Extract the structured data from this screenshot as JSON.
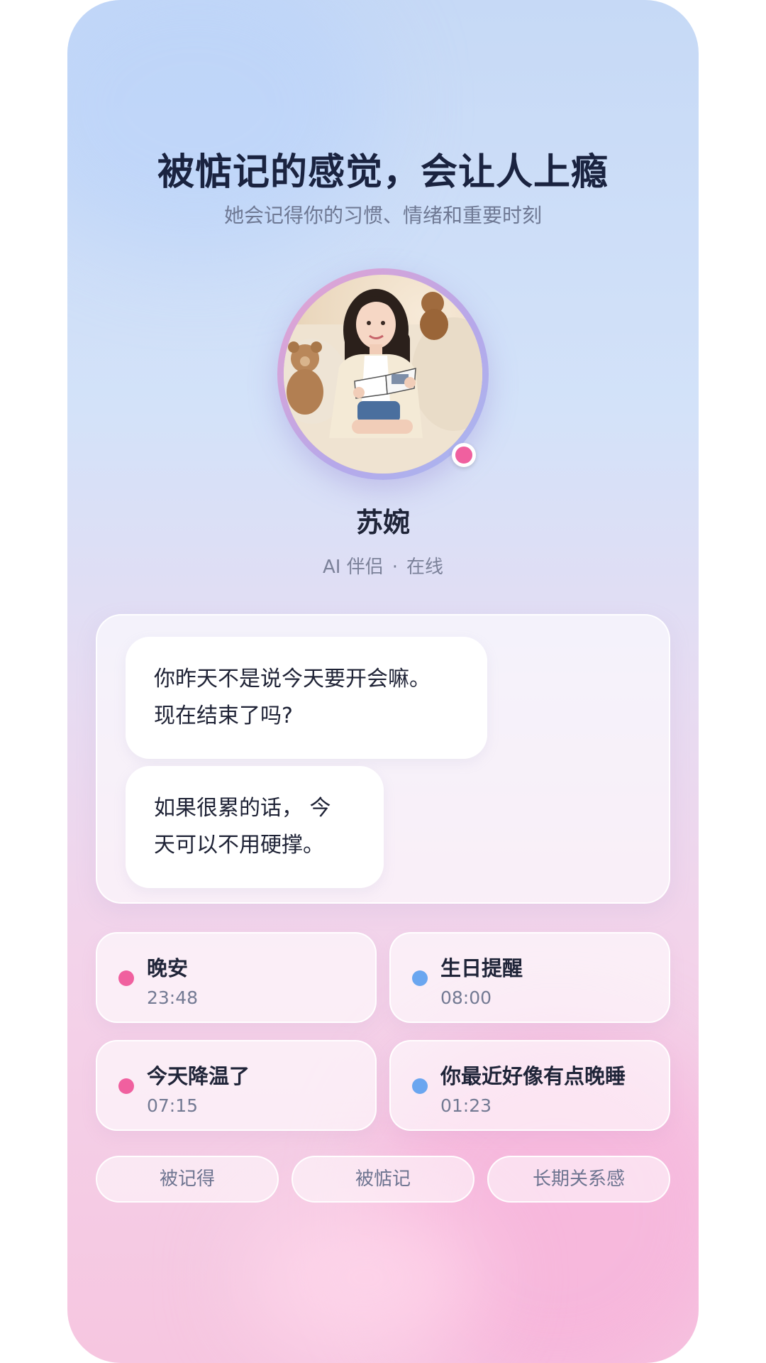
{
  "colors": {
    "pink_accent": "#f0609f",
    "blue_accent": "#6aa6f0",
    "headline": "#1a2340"
  },
  "header": {
    "title": "被惦记的感觉，会让人上瘾",
    "subtitle": "她会记得你的习惯、情绪和重要时刻"
  },
  "profile": {
    "name": "苏婉",
    "role": "AI 伴侣",
    "separator": "·",
    "status": "在线"
  },
  "chat": {
    "messages": [
      {
        "line1": "你昨天不是说今天要开会嘛。",
        "line2": "现在结束了吗?"
      },
      {
        "line1": "如果很累的话， 今",
        "line2": "天可以不用硬撑。"
      }
    ]
  },
  "memories": [
    {
      "title": "晚安",
      "time": "23:48",
      "dot": "pink"
    },
    {
      "title": "生日提醒",
      "time": "08:00",
      "dot": "blue"
    },
    {
      "title": "今天降温了",
      "time": "07:15",
      "dot": "pink"
    },
    {
      "title": "你最近好像有点晚睡",
      "time": "01:23",
      "dot": "blue"
    }
  ],
  "tags": [
    "被记得",
    "被惦记",
    "长期关系感"
  ]
}
